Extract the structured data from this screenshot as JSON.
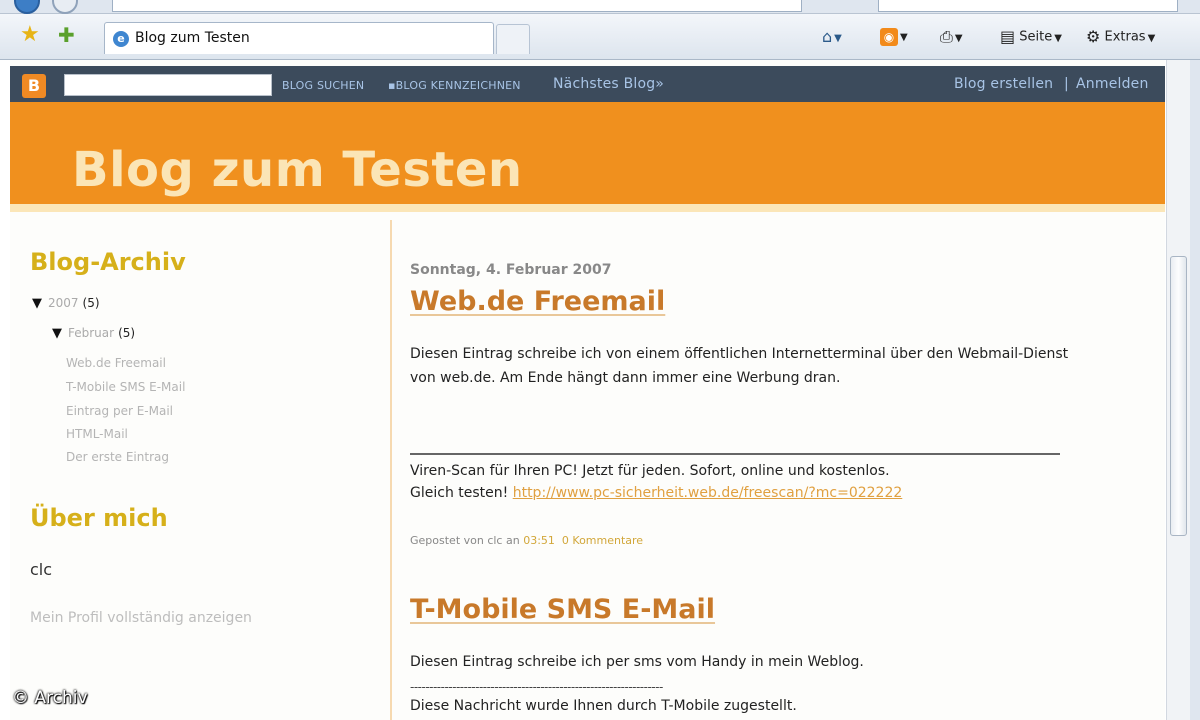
{
  "browser": {
    "tab_title": "Blog zum Testen",
    "tab_icon": "e",
    "tools": {
      "page_label": "Seite",
      "extras_label": "Extras"
    }
  },
  "navbar": {
    "search_value": "",
    "search_blogs": "BLOG SUCHEN",
    "flag_blog": "▪BLOG KENNZEICHNEN",
    "next_blog": "Nächstes Blog»",
    "create_blog": "Blog erstellen",
    "separator": "|",
    "login": "Anmelden",
    "logo": "B"
  },
  "header": {
    "title": "Blog zum Testen"
  },
  "sidebar": {
    "archive_heading": "Blog-Archiv",
    "year": {
      "label": "2007",
      "count": "(5)"
    },
    "month": {
      "label": "Februar",
      "count": "(5)"
    },
    "posts": [
      "Web.de Freemail",
      "T-Mobile SMS E-Mail",
      "Eintrag per E-Mail",
      "HTML-Mail",
      "Der erste Eintrag"
    ],
    "about_heading": "Über mich",
    "author": "clc",
    "profile_link": "Mein Profil vollständig anzeigen"
  },
  "posts": {
    "date": "Sonntag, 4. Februar 2007",
    "post1": {
      "title": "Web.de Freemail",
      "body_line1": "Diesen Eintrag schreibe ich von einem öffentlichen Internetterminal über den Webmail-Dienst",
      "body_line2": "von web.de. Am Ende hängt dann immer eine Werbung dran.",
      "ad_line1": "Viren-Scan für Ihren PC! Jetzt für jeden. Sofort, online und kostenlos.",
      "ad_line2_prefix": "Gleich testen! ",
      "ad_link": "http://www.pc-sicherheit.web.de/freescan/?mc=022222",
      "footer_prefix": "Gepostet von clc an ",
      "time": "03:51",
      "comments": "0 Kommentare"
    },
    "post2": {
      "title": "T-Mobile SMS E-Mail",
      "body": "Diesen Eintrag schreibe ich per sms vom Handy in mein Weblog.",
      "dashes": "------------------------------------------------------------------",
      "note": "Diese Nachricht wurde Ihnen durch T-Mobile zugestellt."
    }
  },
  "watermark": "© Archiv"
}
